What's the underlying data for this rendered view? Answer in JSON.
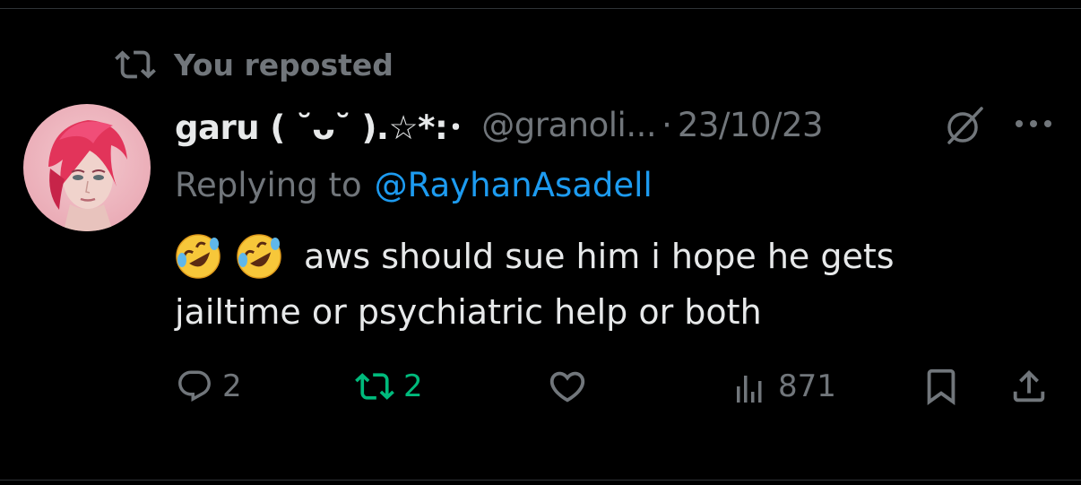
{
  "repost_header": {
    "label": "You reposted"
  },
  "tweet": {
    "display_name": "garu ( ˘ᴗ˘ ).☆*:･",
    "handle": "@granoli...",
    "separator": "·",
    "date": "23/10/23",
    "replying_prefix": "Replying to",
    "replying_mention": "@RayhanAsadell",
    "emojis": [
      "rolling-on-floor-laughing-emoji",
      "rolling-on-floor-laughing-emoji"
    ],
    "text_line1": "aws should sue him i hope he gets",
    "text_line2": "jailtime or psychiatric help or both"
  },
  "actions": {
    "reply_count": "2",
    "repost_count": "2",
    "like_count": "",
    "views_count": "871"
  },
  "colors": {
    "background": "#000000",
    "text": "#e7e9ea",
    "muted": "#71767b",
    "link": "#1d9bf0",
    "reposted_green": "#00ba7c"
  },
  "icons": {
    "repost_header": "repost-icon",
    "grok": "grok-icon",
    "more": "more-icon",
    "reply": "reply-icon",
    "repost": "repost-icon",
    "like": "heart-icon",
    "views": "views-chart-icon",
    "bookmark": "bookmark-icon",
    "share": "share-icon"
  }
}
